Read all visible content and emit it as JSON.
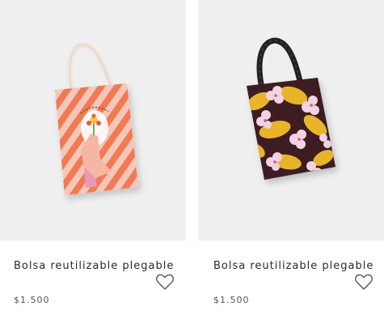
{
  "products": [
    {
      "name": "Bolsa reutilizable plegable",
      "price": "$1.500",
      "image_icon": "tote-bag-orange-stripes",
      "favorite_icon": "heart-outline-icon"
    },
    {
      "name": "Bolsa reutilizable plegable",
      "price": "$1.500",
      "image_icon": "tote-bag-floral",
      "favorite_icon": "heart-outline-icon"
    }
  ],
  "colors": {
    "photo_bg": "#efefef",
    "stripe_orange": "#f07a55",
    "stripe_pink": "#f6c7b8",
    "floral_dark": "#3d1e24",
    "floral_yellow": "#e8b52a",
    "floral_pink": "#f1d3e2"
  }
}
